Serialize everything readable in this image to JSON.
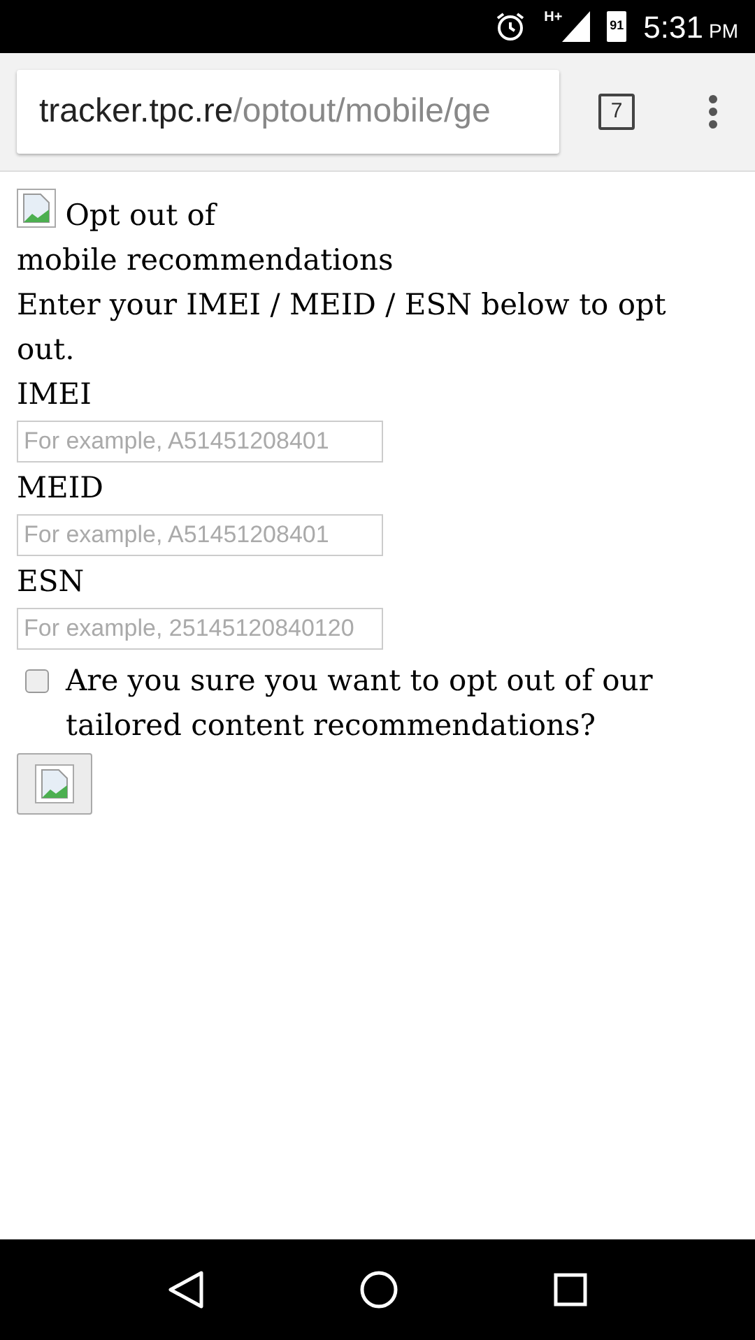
{
  "status_bar": {
    "time": "5:31",
    "ampm": "PM",
    "battery": "91",
    "network": "H+"
  },
  "browser": {
    "url_host": "tracker.tpc.re",
    "url_path": "/optout/mobile/ge",
    "tab_count": "7"
  },
  "page": {
    "heading_lines": [
      "Opt out of",
      "mobile recommendations"
    ],
    "intro": "Enter your IMEI / MEID / ESN below to opt out.",
    "fields": [
      {
        "label": "IMEI",
        "placeholder": "For example, A51451208401"
      },
      {
        "label": "MEID",
        "placeholder": "For example, A51451208401"
      },
      {
        "label": "ESN",
        "placeholder": "For example, 25145120840120"
      }
    ],
    "confirm": {
      "label": "Are you sure you want to opt out of our tailored content recommendations?",
      "checked": false
    }
  }
}
